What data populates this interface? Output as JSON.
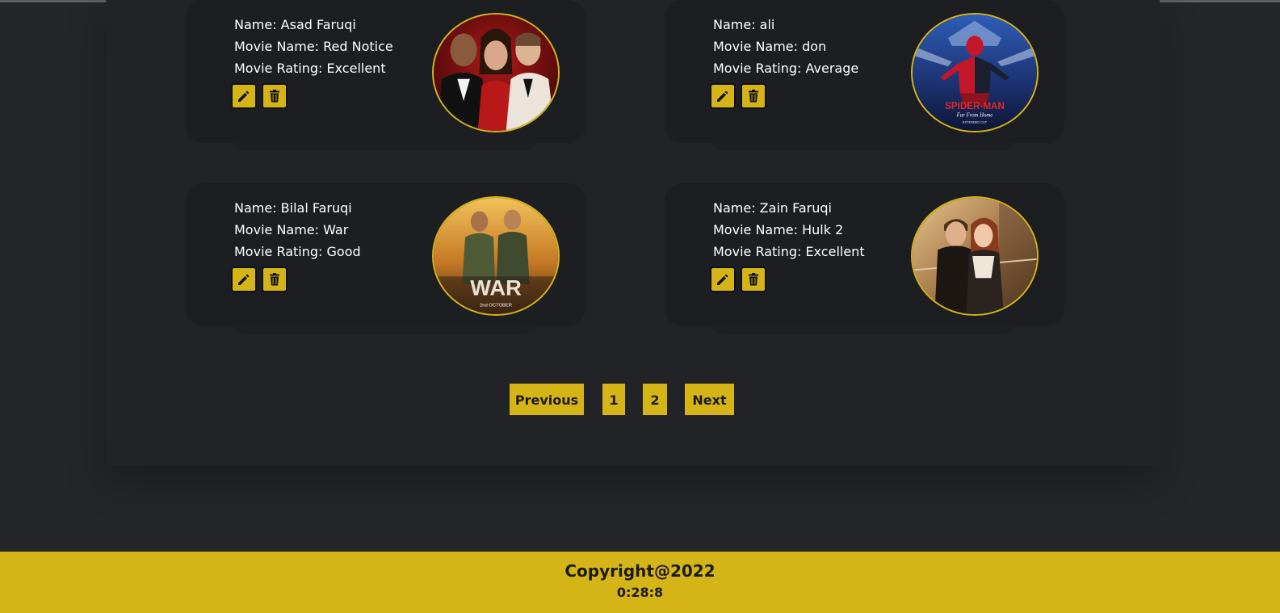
{
  "cards": [
    {
      "name": "Name: Asad Faruqi",
      "movie": "Movie Name: Red Notice",
      "rating": "Movie Rating: Excellent",
      "poster_icon": "red-notice-poster"
    },
    {
      "name": "Name: ali",
      "movie": "Movie Name: don",
      "rating": "Movie Rating: Average",
      "poster_icon": "spider-man-poster",
      "poster_title": "SPIDER-MAN",
      "poster_subtitle": "Far From Home",
      "poster_tag": "EXTENDED CUT"
    },
    {
      "name": "Name: Bilal Faruqi",
      "movie": "Movie Name: War",
      "rating": "Movie Rating: Good",
      "poster_icon": "war-poster",
      "poster_title": "WAR",
      "poster_tag": "2nd OCTOBER"
    },
    {
      "name": "Name: Zain Faruqi",
      "movie": "Movie Name: Hulk 2",
      "rating": "Movie Rating: Excellent",
      "poster_icon": "titanic-poster"
    }
  ],
  "pagination": {
    "previous": "Previous",
    "page1": "1",
    "page2": "2",
    "next": "Next"
  },
  "footer": {
    "copyright": "Copyright@2022",
    "time": "0:28:8"
  },
  "colors": {
    "background": "#25262a",
    "card": "#1d1e21",
    "accent": "#d4b417",
    "text": "#ffffff"
  },
  "icons": {
    "edit": "pencil-icon",
    "delete": "trash-icon"
  }
}
